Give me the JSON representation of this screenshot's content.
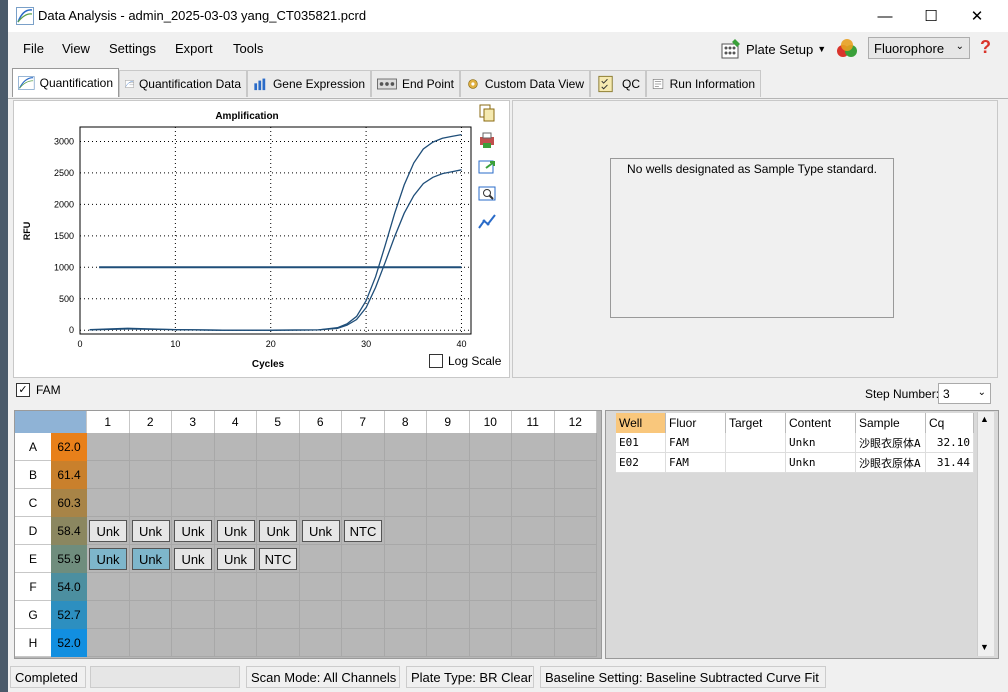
{
  "window": {
    "title": "Data Analysis - admin_2025-03-03 yang_CT035821.pcrd"
  },
  "menu": [
    "File",
    "View",
    "Settings",
    "Export",
    "Tools"
  ],
  "toolbar": {
    "plate_setup": "Plate Setup",
    "fluorophore": "Fluorophore"
  },
  "tabs": [
    "Quantification",
    "Quantification Data",
    "Gene Expression",
    "End Point",
    "Custom Data View",
    "QC",
    "Run Information"
  ],
  "chart_data": {
    "type": "line",
    "title": "Amplification",
    "xlabel": "Cycles",
    "ylabel": "RFU",
    "xlim": [
      0,
      41
    ],
    "ylim": [
      -60,
      3230
    ],
    "x_ticks": [
      "0",
      "10",
      "20",
      "30",
      "40"
    ],
    "y_ticks": [
      "0",
      "500",
      "1000",
      "1500",
      "2000",
      "2500",
      "3000"
    ],
    "grid": true,
    "threshold": 1000,
    "series": [
      {
        "x": [
          1,
          5,
          10,
          15,
          20,
          25,
          27,
          28,
          29,
          30,
          31,
          32,
          33,
          34,
          35,
          36,
          37,
          38,
          39,
          40
        ],
        "y": [
          10,
          30,
          10,
          0,
          0,
          5,
          40,
          100,
          220,
          470,
          850,
          1350,
          1860,
          2310,
          2660,
          2880,
          2990,
          3050,
          3080,
          3110
        ]
      },
      {
        "x": [
          1,
          5,
          10,
          15,
          20,
          25,
          27,
          28,
          29,
          30,
          31,
          32,
          33,
          34,
          35,
          36,
          37,
          38,
          39,
          40
        ],
        "y": [
          5,
          20,
          10,
          0,
          0,
          5,
          30,
          80,
          170,
          360,
          680,
          1080,
          1490,
          1860,
          2140,
          2330,
          2430,
          2490,
          2520,
          2550
        ]
      }
    ],
    "color": "#1f4e79"
  },
  "log_scale_label": "Log Scale",
  "std_message": "No wells designated as Sample Type standard.",
  "fam_label": "FAM",
  "step": {
    "label": "Step Number:",
    "value": "3"
  },
  "plate": {
    "columns": [
      "1",
      "2",
      "3",
      "4",
      "5",
      "6",
      "7",
      "8",
      "9",
      "10",
      "11",
      "12"
    ],
    "rows": [
      {
        "label": "A",
        "temp": "62.0",
        "color": "#e8801a",
        "wells": []
      },
      {
        "label": "B",
        "temp": "61.4",
        "color": "#c9802c",
        "wells": []
      },
      {
        "label": "C",
        "temp": "60.3",
        "color": "#a88447",
        "wells": []
      },
      {
        "label": "D",
        "temp": "58.4",
        "color": "#8b8760",
        "wells": [
          "Unk",
          "Unk",
          "Unk",
          "Unk",
          "Unk",
          "Unk",
          "NTC"
        ]
      },
      {
        "label": "E",
        "temp": "55.9",
        "color": "#6f8d7d",
        "wells": [
          "Unk",
          "Unk",
          "Unk",
          "Unk",
          "NTC"
        ]
      },
      {
        "label": "F",
        "temp": "54.0",
        "color": "#4c8fa0",
        "wells": []
      },
      {
        "label": "G",
        "temp": "52.7",
        "color": "#2d8fc0",
        "wells": []
      },
      {
        "label": "H",
        "temp": "52.0",
        "color": "#128fe0",
        "wells": []
      }
    ]
  },
  "table": {
    "headers": [
      "Well",
      "Fluor",
      "Target",
      "Content",
      "Sample",
      "Cq"
    ],
    "rows": [
      [
        "E01",
        "FAM",
        "",
        "Unkn",
        "沙眼衣原体A",
        "32.10"
      ],
      [
        "E02",
        "FAM",
        "",
        "Unkn",
        "沙眼衣原体A",
        "31.44"
      ]
    ]
  },
  "status": {
    "state": "Completed",
    "scan_mode": "Scan Mode: All Channels",
    "plate_type": "Plate Type: BR Clear",
    "baseline": "Baseline Setting: Baseline Subtracted Curve Fit"
  }
}
